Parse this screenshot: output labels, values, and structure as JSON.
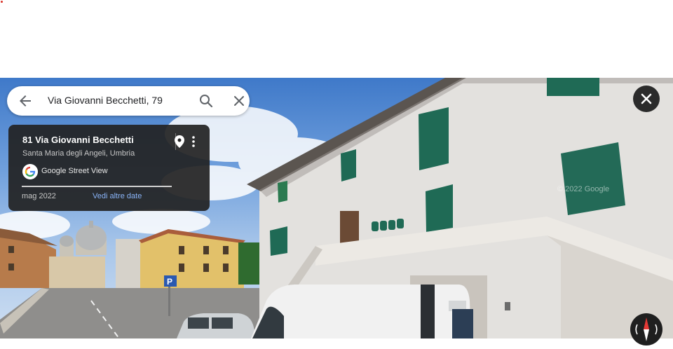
{
  "search": {
    "query": "Via Giovanni Becchetti, 79"
  },
  "info_card": {
    "address": "81 Via Giovanni Becchetti",
    "locality": "Santa Maria degli Angeli, Umbria",
    "source": "Google Street View",
    "date": "mag 2022",
    "more_dates_link": "Vedi altre date"
  },
  "icons": {
    "back": "arrow-left-icon",
    "search": "search-icon",
    "clear": "close-icon",
    "pin": "location-pin-icon",
    "more": "more-vert-icon",
    "logo": "google-g-logo",
    "close_viewer": "close-icon",
    "compass": "compass-icon"
  },
  "watermark": "© 2022 Google",
  "colors": {
    "link": "#8ab4f8",
    "card_bg": "#222222",
    "shutters": "#1f6a55"
  }
}
